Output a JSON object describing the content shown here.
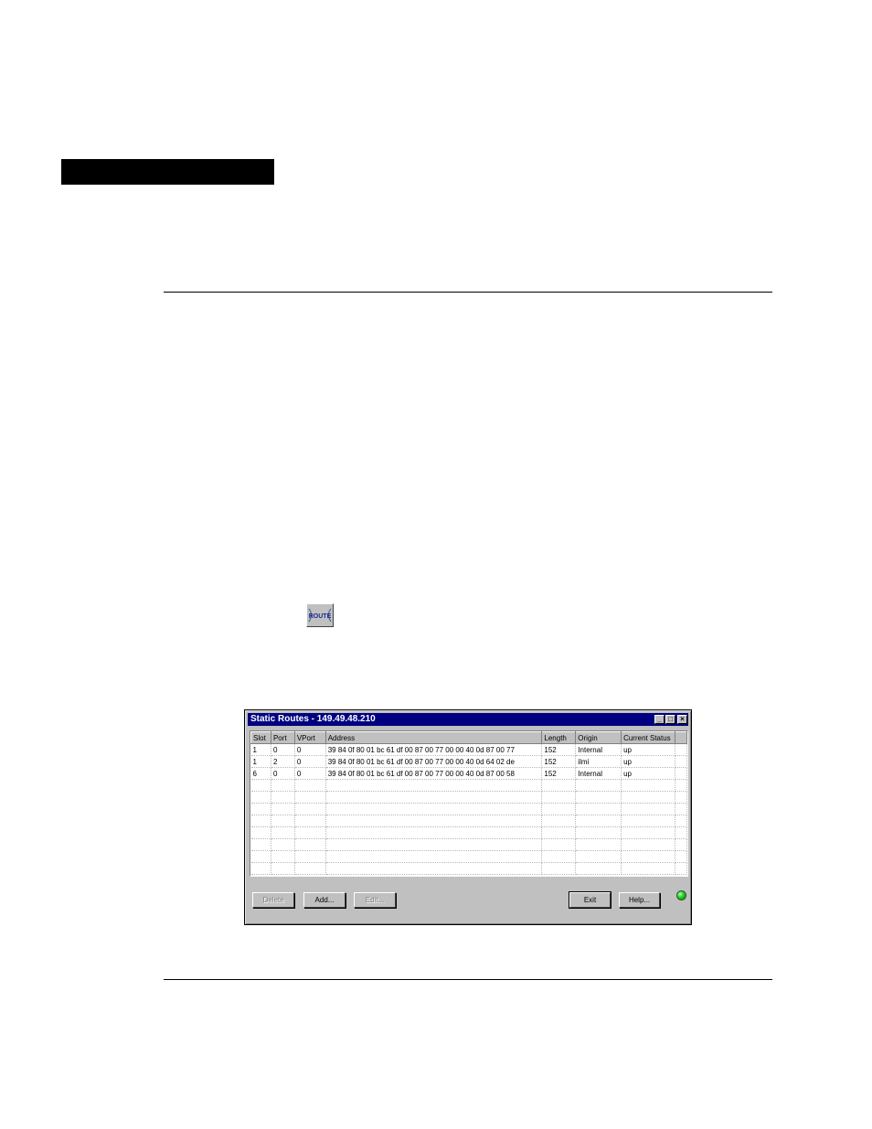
{
  "toolbar_icon": {
    "label": "ROUTE",
    "icon": "route-icon"
  },
  "window": {
    "title": "Static Routes - 149.49.48.210",
    "controls": {
      "minimize": "_",
      "maximize": "□",
      "close": "×"
    },
    "columns": [
      "Slot",
      "Port",
      "VPort",
      "Address",
      "Length",
      "Origin",
      "Current Status"
    ],
    "rows": [
      [
        "1",
        "0",
        "0",
        "39 84 0f 80 01 bc 61 df 00 87 00 77 00 00 40 0d 87 00 77",
        "152",
        "Internal",
        "up"
      ],
      [
        "1",
        "2",
        "0",
        "39 84 0f 80 01 bc 61 df 00 87 00 77 00 00 40 0d 64 02 de",
        "152",
        "ilmi",
        "up"
      ],
      [
        "6",
        "0",
        "0",
        "39 84 0f 80 01 bc 61 df 00 87 00 77 00 00 40 0d 87 00 58",
        "152",
        "Internal",
        "up"
      ]
    ],
    "empty_rows": 8,
    "buttons": {
      "delete": "Delete",
      "add": "Add...",
      "edit": "Edit...",
      "exit": "Exit",
      "help": "Help..."
    },
    "status_led_color": "#22cc22"
  }
}
